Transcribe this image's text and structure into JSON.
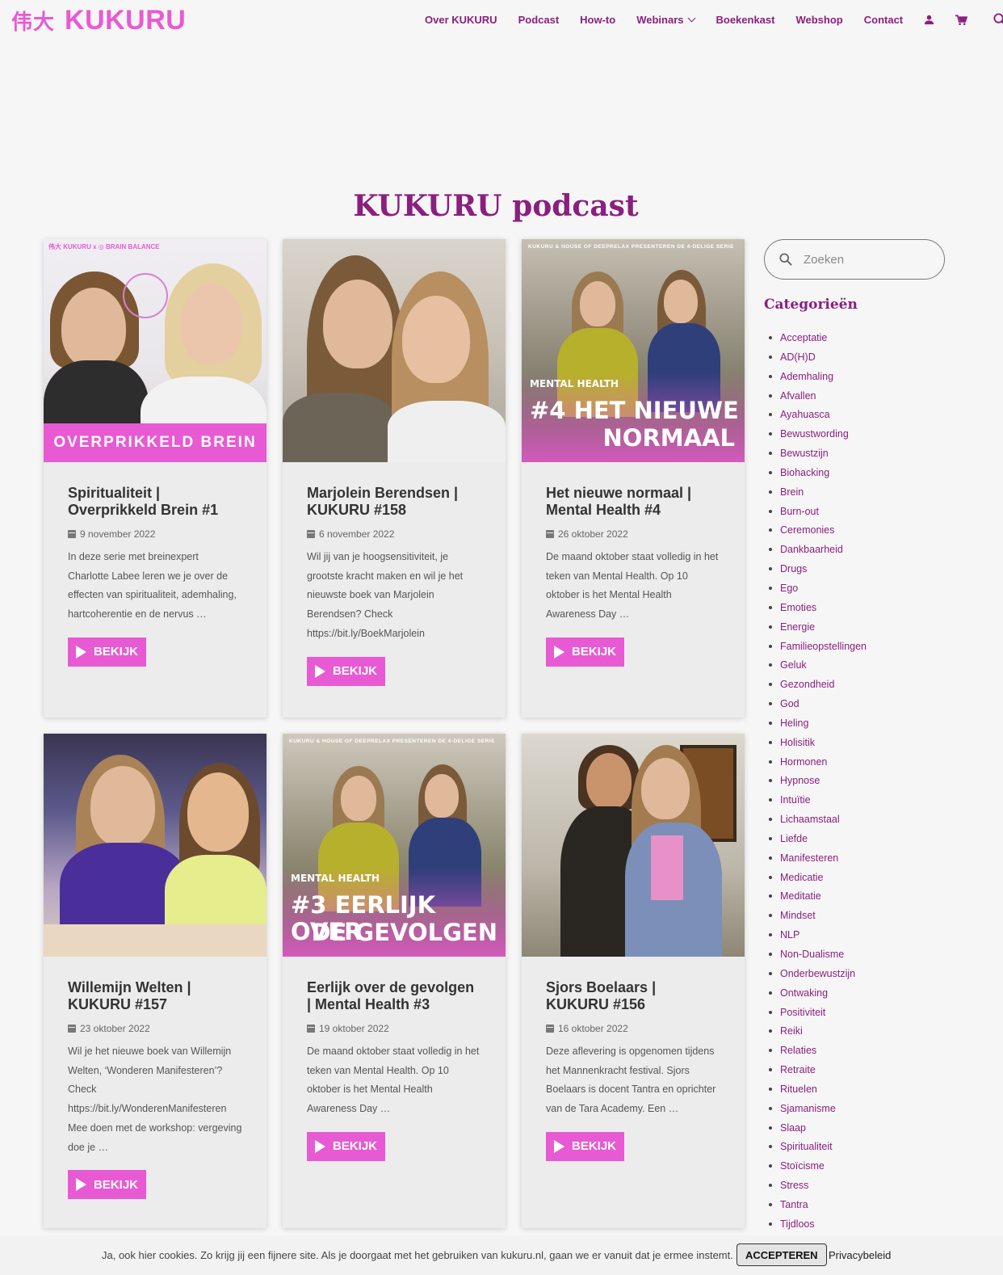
{
  "brand": {
    "cjk": "伟大",
    "name": "KUKURU"
  },
  "nav": {
    "items": [
      {
        "label": "Over KUKURU"
      },
      {
        "label": "Podcast"
      },
      {
        "label": "How-to"
      },
      {
        "label": "Webinars"
      },
      {
        "label": "Boekenkast"
      },
      {
        "label": "Webshop"
      },
      {
        "label": "Contact"
      }
    ],
    "icons": [
      "user-icon",
      "cart-icon",
      "search-icon"
    ]
  },
  "page": {
    "title": "KUKURU podcast"
  },
  "posts": [
    {
      "title": "Spiritualiteit | Overprikkeld Brein #1",
      "date": "9 november 2022",
      "excerpt": "In deze serie met breinexpert Charlotte Labee leren we je over de effecten van spiritualiteit, ademhaling, hartcoherentie en de nervus …",
      "button": "BEKIJK",
      "thumb_top": "伟大 KUKURU x ◎ BRAIN BALANCE",
      "thumb_banner": "OVERPRIKKELD BREIN"
    },
    {
      "title": "Marjolein Berendsen | KUKURU #158",
      "date": "6 november 2022",
      "excerpt": "Wil jij van je hoogsensitiviteit, je grootste kracht maken en wil je het nieuwste boek van Marjolein Berendsen? Check https://bit.ly/BoekMarjolein",
      "button": "BEKIJK"
    },
    {
      "title": "Het nieuwe normaal | Mental Health #4",
      "date": "26 oktober 2022",
      "excerpt": "De maand oktober staat volledig in het teken van Mental Health. Op 10 oktober is het Mental Health Awareness Day …",
      "button": "BEKIJK",
      "thumb_top": "KUKURU & HOUSE OF DEEPRELAX PRESENTEREN DE 4-DELIGE SERIE",
      "thumb_small": "MENTAL HEALTH",
      "thumb_big1": "#4 HET NIEUWE",
      "thumb_big2": "NORMAAL"
    },
    {
      "title": "Willemijn Welten | KUKURU #157",
      "date": "23 oktober 2022",
      "excerpt": "Wil je het nieuwe boek van Willemijn Welten, ‘Wonderen Manifesteren’? Check https://bit.ly/WonderenManifesteren Mee doen met de workshop: vergeving doe je …",
      "button": "BEKIJK"
    },
    {
      "title": "Eerlijk over de gevolgen | Mental Health #3",
      "date": "19 oktober 2022",
      "excerpt": "De maand oktober staat volledig in het teken van Mental Health. Op 10 oktober is het Mental Health Awareness Day …",
      "button": "BEKIJK",
      "thumb_top": "KUKURU & HOUSE OF DEEPRELAX PRESENTEREN DE 4-DELIGE SERIE",
      "thumb_small": "MENTAL HEALTH",
      "thumb_big1": "#3 EERLIJK OVER",
      "thumb_big2": "DE GEVOLGEN"
    },
    {
      "title": "Sjors Boelaars | KUKURU #156",
      "date": "16 oktober 2022",
      "excerpt": "Deze aflevering is opgenomen tijdens het Mannenkracht festival. Sjors Boelaars is docent Tantra en oprichter van de Tara Academy. Een …",
      "button": "BEKIJK"
    }
  ],
  "sidebar": {
    "search_placeholder": "Zoeken",
    "categories_title": "Categorieën",
    "categories": [
      "Acceptatie",
      "AD(H)D",
      "Ademhaling",
      "Afvallen",
      "Ayahuasca",
      "Bewustwording",
      "Bewustzijn",
      "Biohacking",
      "Brein",
      "Burn-out",
      "Ceremonies",
      "Dankbaarheid",
      "Drugs",
      "Ego",
      "Emoties",
      "Energie",
      "Familieopstellingen",
      "Geluk",
      "Gezondheid",
      "God",
      "Heling",
      "Holisitik",
      "Hormonen",
      "Hypnose",
      "Intuïtie",
      "Lichaamstaal",
      "Liefde",
      "Manifesteren",
      "Medicatie",
      "Meditatie",
      "Mindset",
      "NLP",
      "Non-Dualisme",
      "Onderbewustzijn",
      "Ontwaking",
      "Positiviteit",
      "Reiki",
      "Relaties",
      "Retraite",
      "Rituelen",
      "Sjamanisme",
      "Slaap",
      "Spiritualiteit",
      "Stoïcisme",
      "Stress",
      "Tantra",
      "Tijdloos"
    ]
  },
  "cookie": {
    "text": "Ja, ook hier cookies. Zo krijg jij een fijnere site. Als je doorgaat met het gebruiken van kukuru.nl, gaan we er vanuit dat je ermee instemt.",
    "accept": "ACCEPTEREN",
    "privacy": "Privacybeleid"
  },
  "colors": {
    "accent": "#e85ad3",
    "primary": "#8a1f7f"
  }
}
